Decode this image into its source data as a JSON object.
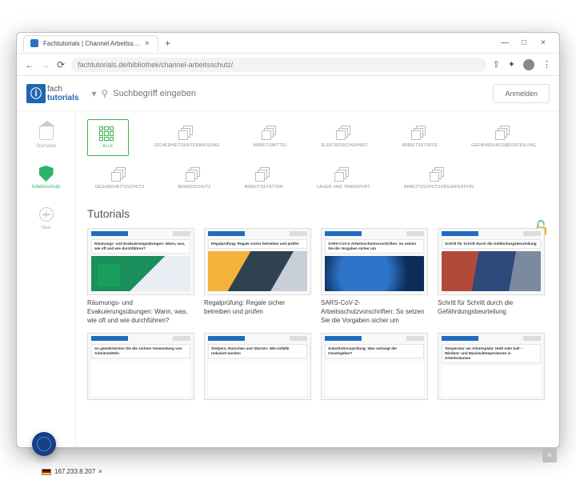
{
  "window": {
    "tab_title": "Fachtutorials | Channel Arbeitss…",
    "minimize": "—",
    "maximize": "□",
    "close": "×"
  },
  "browser": {
    "url": "fachtutorials.de/bibliothek/channel-arbeitsschutz/"
  },
  "logo": {
    "top": "fach",
    "bottom": "tutorials"
  },
  "search": {
    "placeholder": "Suchbegriff eingeben"
  },
  "login_label": "Anmelden",
  "sidebar": {
    "items": [
      {
        "label": "Startseite"
      },
      {
        "label": "Arbeitsschutz"
      },
      {
        "label": "Neu"
      }
    ]
  },
  "filters": [
    {
      "label": "ALLE",
      "active": true
    },
    {
      "label": "SICHERHEITSUNTERWEISUNG"
    },
    {
      "label": "ARBEITSMITTEL"
    },
    {
      "label": "ELEKTROSICHERHEIT"
    },
    {
      "label": "ARBEITSSTOFFE"
    },
    {
      "label": "GEFÄHRDUNGSBEURTEILUNG"
    },
    {
      "label": "GESUNDHEITSSCHUTZ"
    },
    {
      "label": "BRANDSCHUTZ"
    },
    {
      "label": "ARBEITSSTÄTTEN"
    },
    {
      "label": "LAGER UND TRANSPORT"
    },
    {
      "label": "ARBEITSSCHUTZORGANISATION"
    }
  ],
  "section_title": "Tutorials",
  "cards": [
    {
      "strip": "Räumungs- und Evakuierungsübungen: Wann, was, wie oft und wie durchführen?",
      "title": "Räumungs- und Evakuierungsübungen: Wann, was, wie oft und wie durchführen?"
    },
    {
      "strip": "Regalprüfung: Regale sicher betreiben und prüfen",
      "title": "Regalprüfung: Regale sicher betreiben und prüfen"
    },
    {
      "strip": "SARS-CoV-2-Arbeitsschutzvorschriften: So setzen Sie die Vorgaben sicher um",
      "title": "SARS-CoV-2-Arbeitsschutzvorschriften: So setzen Sie die Vorgaben sicher um"
    },
    {
      "strip": "Schritt für Schritt durch die Gefährdungsbeurteilung",
      "title": "Schritt für Schritt durch die Gefährdungsbeurteilung"
    },
    {
      "strip": "So gewährleisten Sie die sichere Verwendung von Arbeitsmitteln",
      "title": ""
    },
    {
      "strip": "Stolpern, Rutschen und Stürzen: Wie Unfälle reduziert werden",
      "title": ""
    },
    {
      "strip": "Substitutionsprüfung: Was verlangt der Gesetzgeber?",
      "title": ""
    },
    {
      "strip": "Temperatur am Arbeitsplatz: Heiß oder kalt – Mindest- und Maximaltemperaturen in Arbeitsräumen",
      "title": ""
    }
  ],
  "ip": "167.233.8.207",
  "ip_close": "×",
  "colors": {
    "accent": "#2db36a",
    "brand": "#1e66b0"
  }
}
